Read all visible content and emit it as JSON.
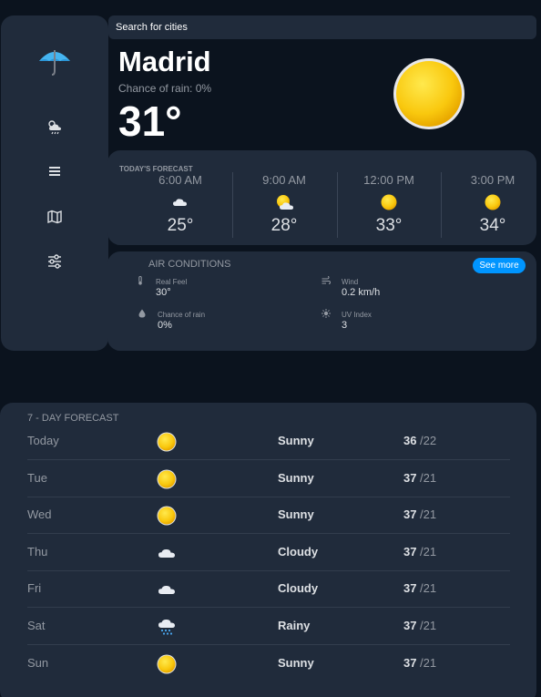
{
  "search": {
    "placeholder": "Search for cities"
  },
  "sidebar": {
    "logo_icon": "umbrella-icon",
    "items": [
      {
        "name": "weather",
        "icon": "cloud-sun-rain-icon"
      },
      {
        "name": "cities",
        "icon": "list-icon"
      },
      {
        "name": "map",
        "icon": "map-icon"
      },
      {
        "name": "settings",
        "icon": "sliders-icon"
      }
    ]
  },
  "current": {
    "city": "Madrid",
    "rain_chance": "Chance of rain: 0%",
    "temperature": "31°",
    "icon": "sun-icon"
  },
  "hourly": {
    "label": "TODAY'S FORECAST",
    "items": [
      {
        "time": "6:00 AM",
        "icon": "cloud-icon",
        "temp": "25°"
      },
      {
        "time": "9:00 AM",
        "icon": "partly-cloudy-icon",
        "temp": "28°"
      },
      {
        "time": "12:00 PM",
        "icon": "sun-icon",
        "temp": "33°"
      },
      {
        "time": "3:00 PM",
        "icon": "sun-icon",
        "temp": "34°"
      }
    ]
  },
  "air": {
    "label": "AIR CONDITIONS",
    "see_more": "See more",
    "real_feel": {
      "label": "Real Feel",
      "value": "30°",
      "icon": "thermometer-icon"
    },
    "wind": {
      "label": "Wind",
      "value": "0.2 km/h",
      "icon": "wind-icon"
    },
    "rain": {
      "label": "Chance of rain",
      "value": "0%",
      "icon": "droplet-icon"
    },
    "uv": {
      "label": "UV Index",
      "value": "3",
      "icon": "sun-small-icon"
    }
  },
  "weekly": {
    "label": "7 - DAY FORECAST",
    "days": [
      {
        "day": "Today",
        "icon": "sun-icon",
        "condition": "Sunny",
        "high": "36",
        "low": " /22"
      },
      {
        "day": "Tue",
        "icon": "sun-icon",
        "condition": "Sunny",
        "high": "37",
        "low": " /21"
      },
      {
        "day": "Wed",
        "icon": "sun-icon",
        "condition": "Sunny",
        "high": "37",
        "low": " /21"
      },
      {
        "day": "Thu",
        "icon": "cloud-icon",
        "condition": "Cloudy",
        "high": "37",
        "low": " /21"
      },
      {
        "day": "Fri",
        "icon": "cloud-icon",
        "condition": "Cloudy",
        "high": "37",
        "low": " /21"
      },
      {
        "day": "Sat",
        "icon": "rain-cloud-icon",
        "condition": "Rainy",
        "high": "37",
        "low": " /21"
      },
      {
        "day": "Sun",
        "icon": "sun-icon",
        "condition": "Sunny",
        "high": "37",
        "low": " /21"
      }
    ]
  },
  "colors": {
    "background": "#0b131e",
    "panel": "#202b3b",
    "accent": "#0095ff",
    "sun": "#fcd413"
  }
}
